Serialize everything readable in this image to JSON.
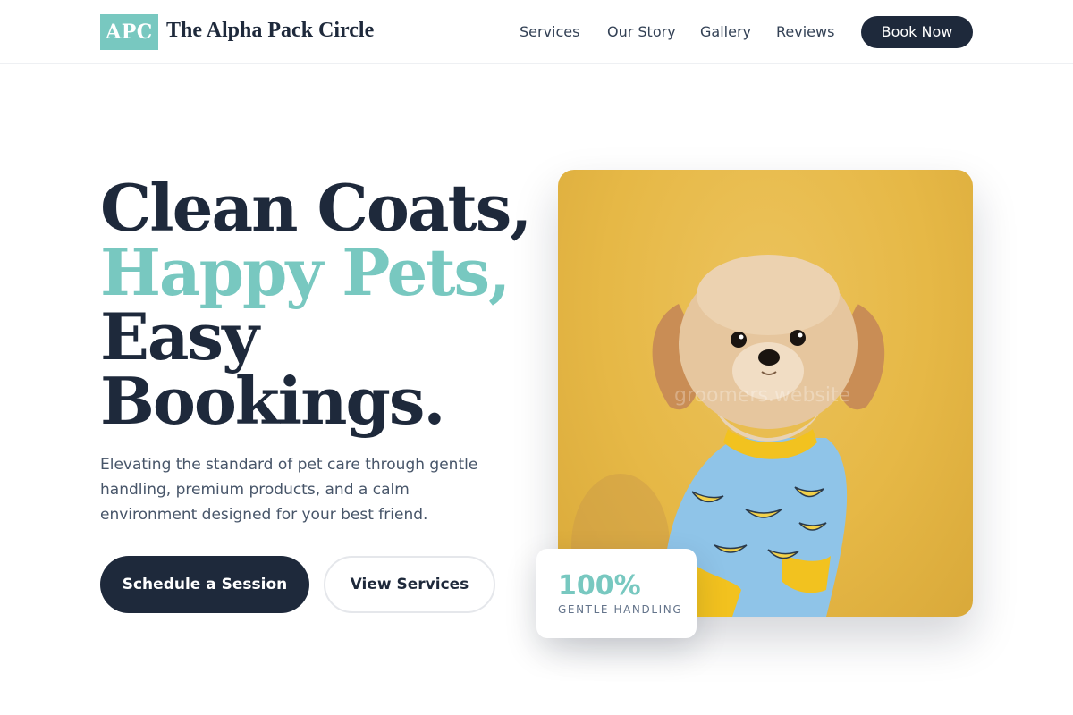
{
  "header": {
    "logo_text": "APC",
    "brand_name": "The Alpha Pack Circle",
    "nav": [
      {
        "label": "Services"
      },
      {
        "label": "Our Story"
      },
      {
        "label": "Gallery"
      },
      {
        "label": "Reviews"
      }
    ],
    "cta_label": "Book Now"
  },
  "hero": {
    "headline_lines": [
      "Clean Coats,",
      "Happy Pets,",
      "Easy",
      "Bookings."
    ],
    "description": "Elevating the standard of pet care through gentle handling, premium products, and a calm environment designed for your best friend.",
    "primary_button": "Schedule a Session",
    "secondary_button": "View Services",
    "image_watermark": "groomers.website"
  },
  "stat": {
    "value": "100%",
    "label": "GENTLE HANDLING"
  },
  "colors": {
    "accent": "#78c8c0",
    "navy": "#1e293b",
    "photo_background": "#e6b846",
    "shirt": "#8fc4e8"
  }
}
